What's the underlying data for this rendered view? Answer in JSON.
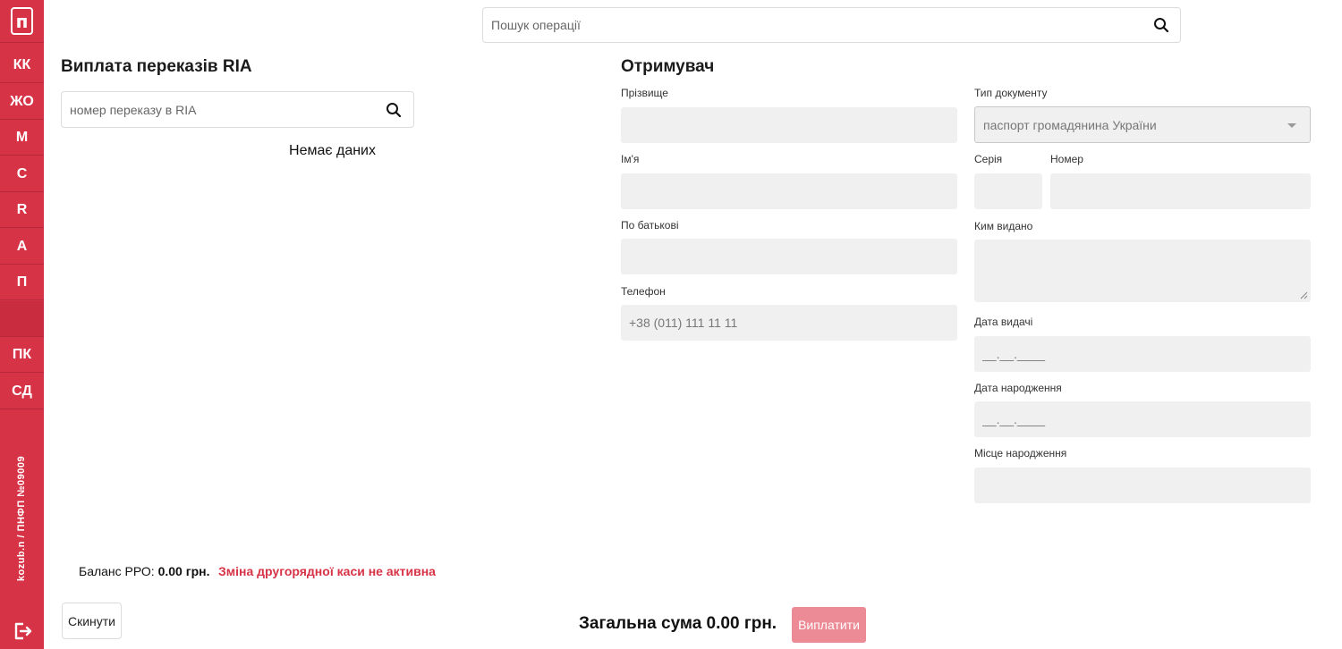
{
  "sidebar": {
    "logo": "п",
    "items": [
      "КК",
      "ЖО",
      "М",
      "С",
      "R",
      "А",
      "П",
      "",
      "ПК",
      "СД"
    ],
    "user": "kozub.n / ПНФП №09009"
  },
  "search": {
    "placeholder": "Пошук операції",
    "value": ""
  },
  "left": {
    "title": "Виплата переказів RIA",
    "search_placeholder": "номер переказу в RIA",
    "empty": "Немає даних"
  },
  "recipient": {
    "title": "Отримувач",
    "surname_label": "Прізвище",
    "name_label": "Ім'я",
    "patronymic_label": "По батькові",
    "phone_label": "Телефон",
    "phone_placeholder": "+38 (011) 111 11 11",
    "doc_type_label": "Тип документу",
    "doc_type_value": "паспорт громадянина України",
    "series_label": "Серія",
    "number_label": "Номер",
    "issued_by_label": "Ким видано",
    "issue_date_label": "Дата видачі",
    "issue_date_placeholder": "__.__.____",
    "birth_date_label": "Дата народження",
    "birth_date_placeholder": "__.__.____",
    "birth_place_label": "Місце народження"
  },
  "footer": {
    "balance_label": "Баланс РРО:",
    "balance_value": "0.00 грн.",
    "shift_warning": "Зміна другорядної каси не активна",
    "reset_label": "Скинути",
    "total": "Загальна сума 0.00 грн.",
    "pay_label": "Виплатити"
  },
  "colors": {
    "brand": "#d73346",
    "pay_disabled": "#ec8a96",
    "field_bg": "#f0f0f0"
  }
}
